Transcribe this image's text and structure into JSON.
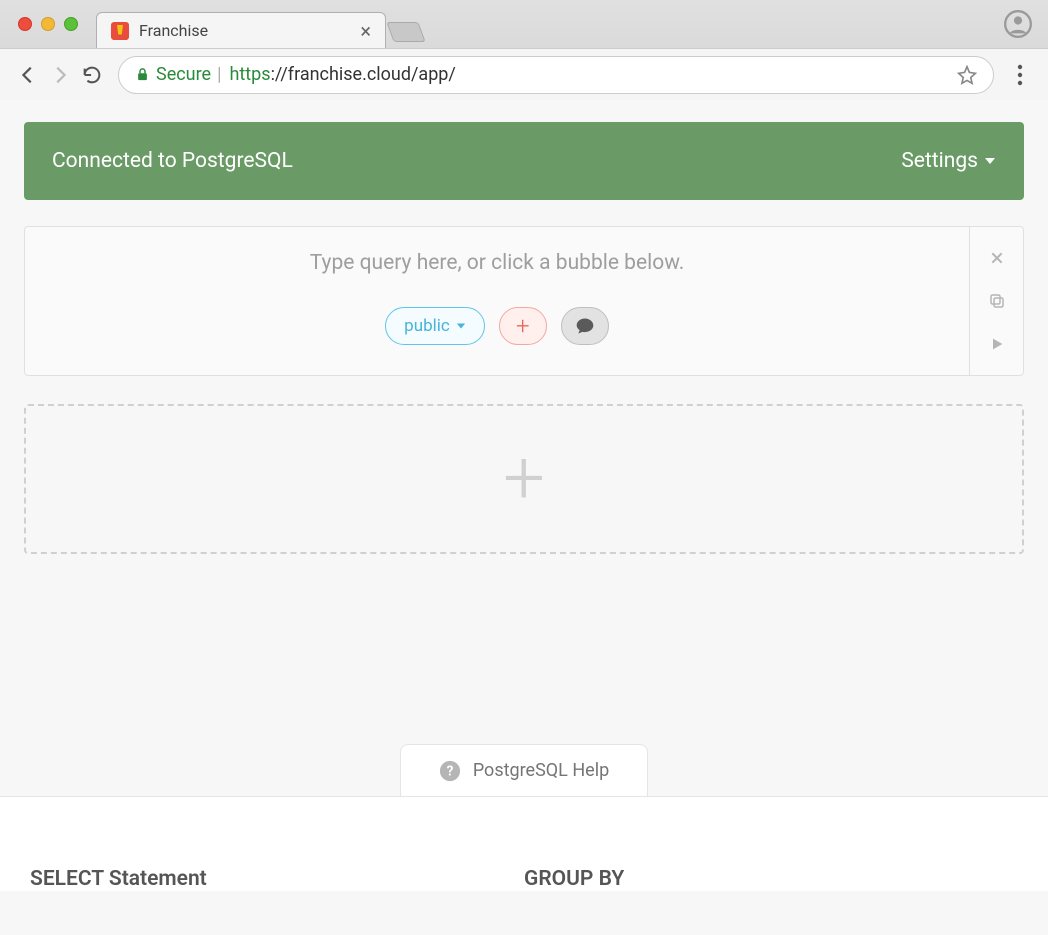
{
  "browser": {
    "tab_title": "Franchise",
    "secure_label": "Secure",
    "url_protocol": "https",
    "url_rest": "://franchise.cloud/app/"
  },
  "banner": {
    "status": "Connected to PostgreSQL",
    "settings_label": "Settings"
  },
  "query": {
    "placeholder": "Type query here, or click a bubble below.",
    "public_label": "public"
  },
  "help": {
    "tab_label": "PostgreSQL Help",
    "col1_heading": "SELECT Statement",
    "col2_heading": "GROUP BY"
  }
}
